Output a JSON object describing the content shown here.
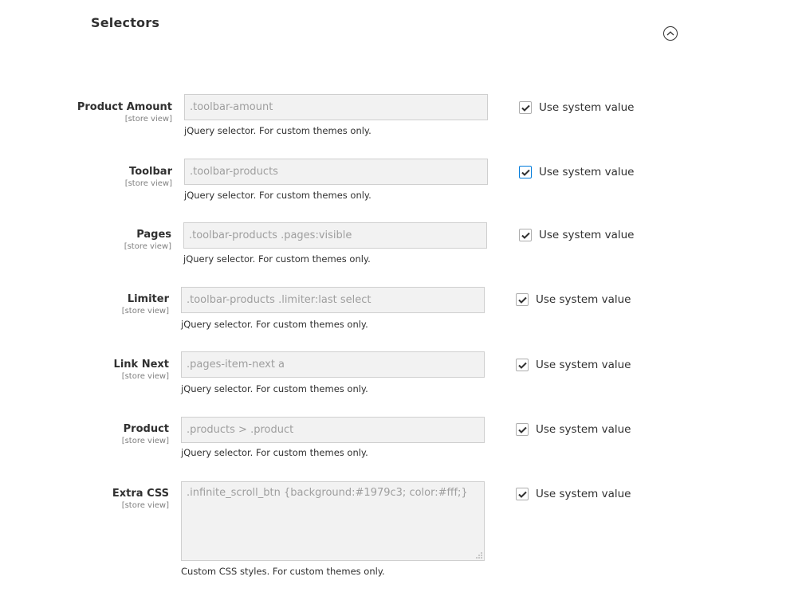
{
  "section": {
    "title": "Selectors",
    "collapse_icon": "chevron-up-circle-icon"
  },
  "fields": [
    {
      "label": "Product Amount",
      "scope": "[store view]",
      "value": ".toolbar-amount",
      "note": "jQuery selector. For custom themes only.",
      "use_system_value_label": "Use system value",
      "use_system_value": true,
      "focused": false,
      "type": "input"
    },
    {
      "label": "Toolbar",
      "scope": "[store view]",
      "value": ".toolbar-products",
      "note": "jQuery selector. For custom themes only.",
      "use_system_value_label": "Use system value",
      "use_system_value": true,
      "focused": true,
      "type": "input"
    },
    {
      "label": "Pages",
      "scope": "[store view]",
      "value": ".toolbar-products .pages:visible",
      "note": "jQuery selector. For custom themes only.",
      "use_system_value_label": "Use system value",
      "use_system_value": true,
      "focused": false,
      "type": "input"
    },
    {
      "label": "Limiter",
      "scope": "[store view]",
      "value": ".toolbar-products .limiter:last select",
      "note": "jQuery selector. For custom themes only.",
      "use_system_value_label": "Use system value",
      "use_system_value": true,
      "focused": false,
      "type": "input"
    },
    {
      "label": "Link Next",
      "scope": "[store view]",
      "value": ".pages-item-next a",
      "note": "jQuery selector. For custom themes only.",
      "use_system_value_label": "Use system value",
      "use_system_value": true,
      "focused": false,
      "type": "input"
    },
    {
      "label": "Product",
      "scope": "[store view]",
      "value": ".products > .product",
      "note": "jQuery selector. For custom themes only.",
      "use_system_value_label": "Use system value",
      "use_system_value": true,
      "focused": false,
      "type": "input"
    },
    {
      "label": "Extra CSS",
      "scope": "[store view]",
      "value": ".infinite_scroll_btn {background:#1979c3; color:#fff;}",
      "note": "Custom CSS styles. For custom themes only.",
      "use_system_value_label": "Use system value",
      "use_system_value": true,
      "focused": false,
      "type": "textarea"
    }
  ],
  "colors": {
    "focus_border": "#007bdb",
    "disabled_input_bg": "#f2f2f2",
    "text": "#303030"
  }
}
